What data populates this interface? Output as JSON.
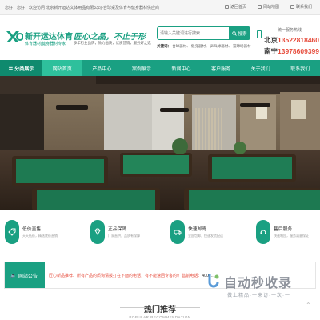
{
  "topbar": {
    "greeting": "您好！您好！欢迎访问 北京新开运达文体用品有限公司-台球桌及体育与健身器材供应商",
    "links": [
      "返回首页",
      "网站地图",
      "联系我们"
    ]
  },
  "brand": {
    "name": "新开运达体育",
    "tagline": "体育器材|健身器材专家",
    "slogan": "匠心之品，不止于形",
    "slogan_sub": "多年行业品牌，致力画质，优质营销，服务好之选"
  },
  "search": {
    "placeholder": "请输入关键词进行搜索...",
    "button": "搜索",
    "hot_label": "关键词：",
    "hot_words": [
      "台球器材",
      "健身器材",
      "乒乓球器材",
      "篮球场器材"
    ]
  },
  "hotline": {
    "label": "统一服务热线",
    "line1_city": "北京",
    "line1_number": "13522818460",
    "line2_city": "南宁",
    "line2_number": "13978609399"
  },
  "nav": {
    "category": "分类展示",
    "items": [
      "网站首页",
      "产品中心",
      "案例展示",
      "新闻中心",
      "客户服务",
      "关于我们",
      "联系我们"
    ],
    "active_index": 0
  },
  "services": [
    {
      "title": "低价直售",
      "sub": "天天低价，精选底价直销",
      "icon": "price-tag-icon"
    },
    {
      "title": "正品保障",
      "sub": "厂家直供，品质有保障",
      "icon": "diamond-icon"
    },
    {
      "title": "快速邮寄",
      "sub": "全国包邮，快速发货配送",
      "icon": "shipping-icon"
    },
    {
      "title": "售后服务",
      "sub": "快速响应，服务满意保证",
      "icon": "service-icon"
    }
  ],
  "notice": {
    "label": "网站公告:",
    "text": "匠心新品推荐、所有产品的质询请拨打在下面的电话，有不能速回专客的!！售前电话：",
    "tel": "400-..."
  },
  "watermark": {
    "big": "自动秒收录",
    "small": "做上精品·一来访·一次·一"
  },
  "hot": {
    "title": "热门推荐",
    "sub": "POPULAR RECOMMENDATION"
  },
  "colors": {
    "brand": "#1aa082",
    "brand_dark": "#0f8a6e",
    "accent_red": "#e64d3d"
  }
}
